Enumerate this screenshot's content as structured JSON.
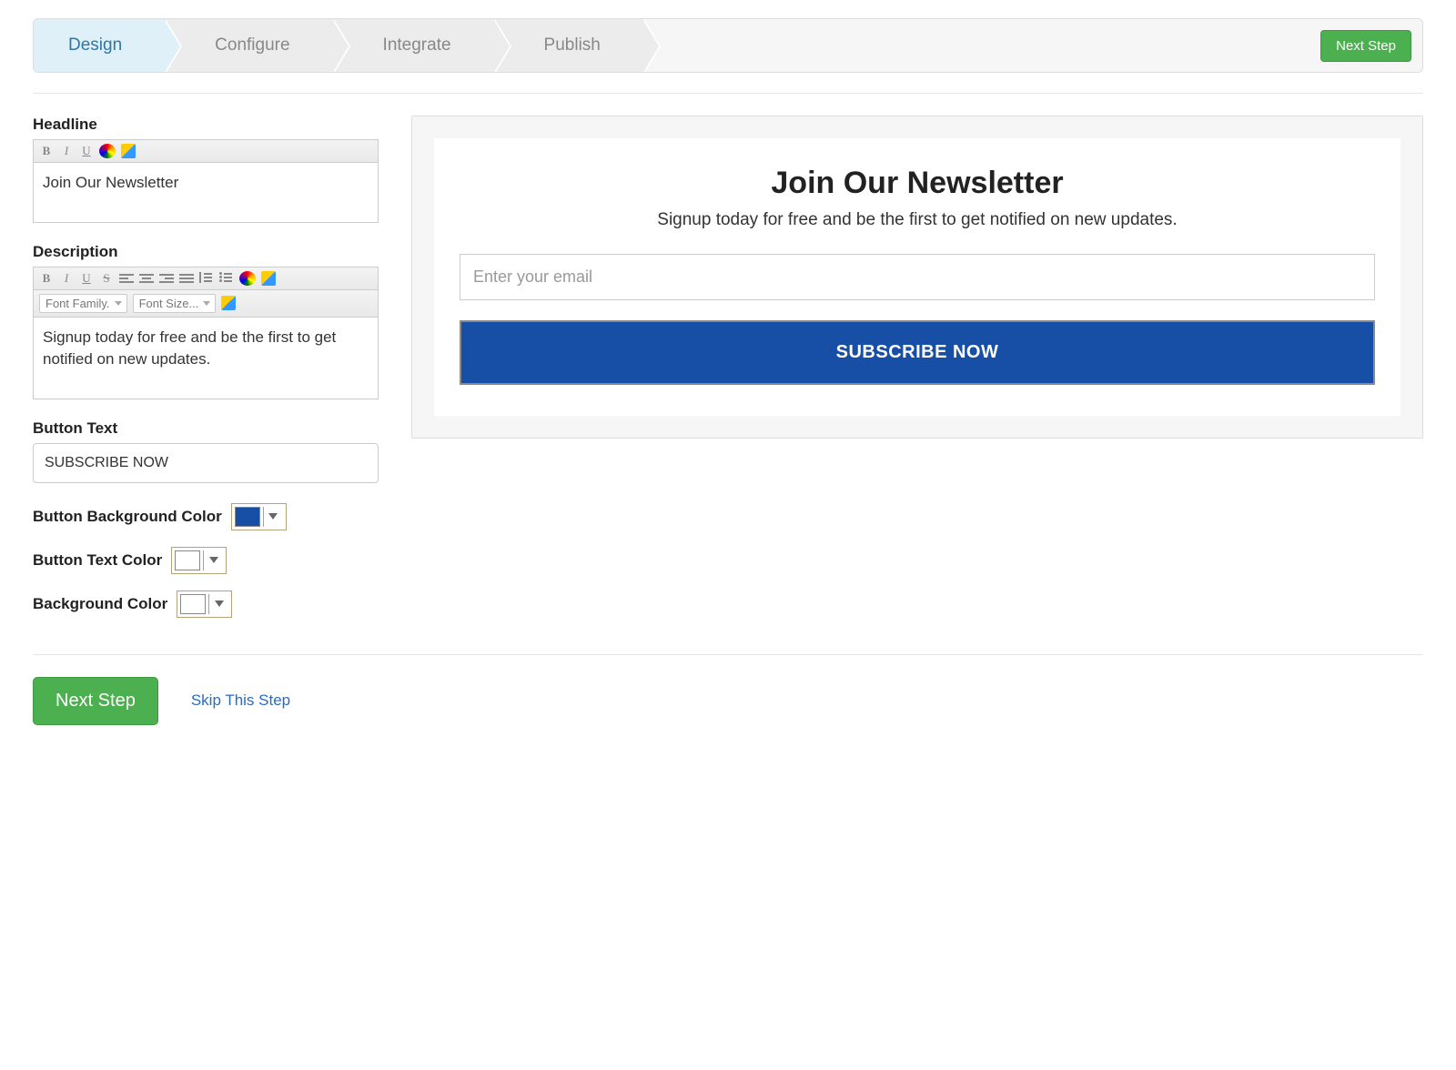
{
  "wizard": {
    "steps": [
      "Design",
      "Configure",
      "Integrate",
      "Publish"
    ],
    "active_index": 0,
    "next_label": "Next Step"
  },
  "form": {
    "headline_label": "Headline",
    "headline_value": "Join Our Newsletter",
    "description_label": "Description",
    "description_value": "Signup today for free and be the first to get notified on new updates.",
    "button_text_label": "Button Text",
    "button_text_value": "SUBSCRIBE NOW",
    "font_family_label": "Font Family.",
    "font_size_label": "Font Size...",
    "btn_bg_label": "Button Background Color",
    "btn_bg_value": "#174ea6",
    "btn_text_color_label": "Button Text Color",
    "btn_text_color_value": "#ffffff",
    "bg_color_label": "Background Color",
    "bg_color_value": "#ffffff"
  },
  "preview": {
    "headline": "Join Our Newsletter",
    "description": "Signup today for free and be the first to get notified on new updates.",
    "email_placeholder": "Enter your email",
    "button_label": "SUBSCRIBE NOW"
  },
  "footer": {
    "next_label": "Next Step",
    "skip_label": "Skip This Step"
  }
}
